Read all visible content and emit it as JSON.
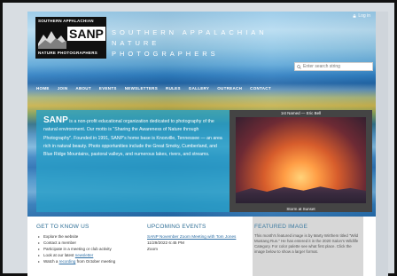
{
  "header": {
    "login_label": "Log in",
    "logo_top": "SOUTHERN APPALACHIAN",
    "logo_main": "SANP",
    "logo_bottom": "NATURE PHOTOGRAPHERS",
    "title_line1": "SOUTHERN APPALACHIAN NATURE",
    "title_line2": "PHOTOGRAPHERS",
    "search_placeholder": "Enter search string"
  },
  "nav": {
    "items": [
      "HOME",
      "JOIN",
      "ABOUT",
      "EVENTS",
      "NEWSLETTERS",
      "RULES",
      "GALLERY",
      "OUTREACH",
      "CONTACT"
    ]
  },
  "about": {
    "name": "SANP",
    "text": " is a non-profit educational organization dedicated to photography of the natural environment. Our motto is \"Sharing the Awareness of Nature through Photography\". Founded in 1991, SANP's home base is Knoxville, Tennessee — an area rich in natural beauty. Photo opportunities include the Great Smoky, Cumberland, and Blue Ridge Mountains, pastoral valleys, and numerous lakes, rivers, and streams."
  },
  "featured_photo": {
    "caption_top": "1st Named — Eric Bell",
    "caption_bottom": "Storm at Sunset"
  },
  "get_to_know": {
    "title": "GET TO KNOW US",
    "items": [
      {
        "text": "Explore the website"
      },
      {
        "text": "Contact a member"
      },
      {
        "text": "Participate in a meeting or club activity"
      },
      {
        "text": "Look at our latest ",
        "link": "newsletter"
      },
      {
        "text": "Watch a ",
        "link": "recording",
        "suffix": " from October meeting"
      }
    ]
  },
  "events": {
    "title": "UPCOMING EVENTS",
    "link": "SANP November Zoom Meeting with Tom Jones",
    "date": "11/29/2022 6:45 PM",
    "location": "Zoom"
  },
  "featured_image": {
    "title": "FEATURED IMAGE",
    "text": "This month's featured image is by Marty Wirthem titled \"Wild Mustang Run.\" He has entered it in the 2020 Salon's Wildlife Category. For color palette see what first place. Click the image below to show a larger format."
  },
  "colors": {
    "about_bg": "#28a0c8",
    "link": "#2e6fa5",
    "heading": "#2f6f96"
  }
}
